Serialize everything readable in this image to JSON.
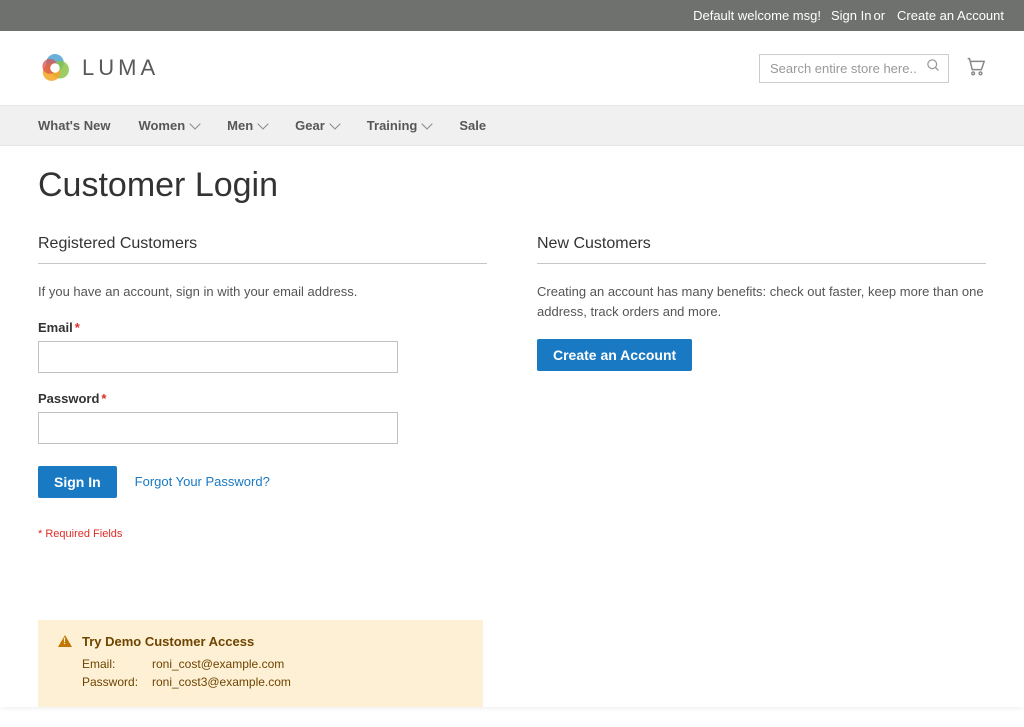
{
  "panel": {
    "welcome": "Default welcome msg!",
    "sign_in": "Sign In",
    "or": "or",
    "create_account": "Create an Account"
  },
  "logo": {
    "text": "LUMA"
  },
  "search": {
    "placeholder": "Search entire store here..."
  },
  "nav": {
    "items": [
      {
        "label": "What's New",
        "dropdown": false
      },
      {
        "label": "Women",
        "dropdown": true
      },
      {
        "label": "Men",
        "dropdown": true
      },
      {
        "label": "Gear",
        "dropdown": true
      },
      {
        "label": "Training",
        "dropdown": true
      },
      {
        "label": "Sale",
        "dropdown": false
      }
    ]
  },
  "page": {
    "title": "Customer Login"
  },
  "login": {
    "block_title": "Registered Customers",
    "note": "If you have an account, sign in with your email address.",
    "email_label": "Email",
    "password_label": "Password",
    "sign_in_btn": "Sign In",
    "forgot_link": "Forgot Your Password?",
    "required_note": "* Required Fields"
  },
  "new": {
    "block_title": "New Customers",
    "note": "Creating an account has many benefits: check out faster, keep more than one address, track orders and more.",
    "create_btn": "Create an Account"
  },
  "demo": {
    "title": "Try Demo Customer Access",
    "email_label": "Email:",
    "email_value": "roni_cost@example.com",
    "password_label": "Password:",
    "password_value": "roni_cost3@example.com"
  }
}
